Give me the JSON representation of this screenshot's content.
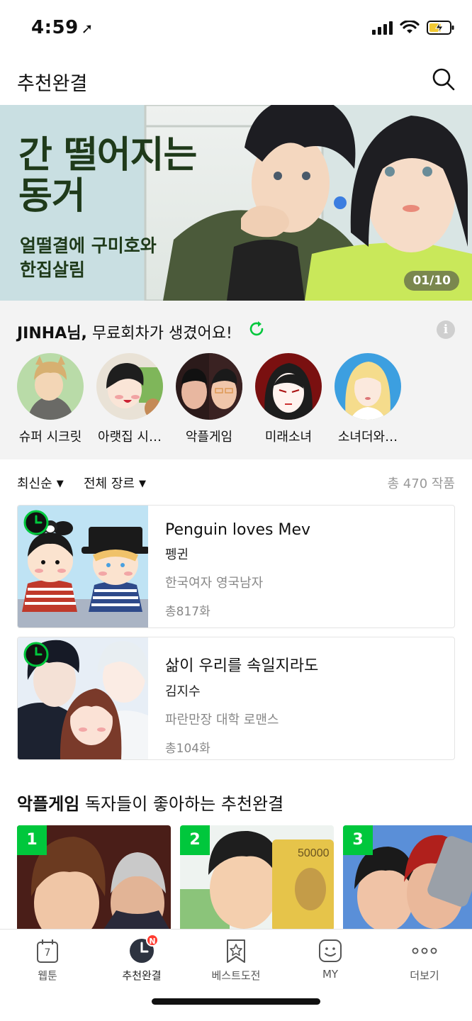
{
  "status_bar": {
    "time": "4:59"
  },
  "header": {
    "title": "추천완결"
  },
  "banner": {
    "title_line1": "간 떨어지는",
    "title_line2": "동거",
    "subtitle_line1": "얼떨결에 구미호와",
    "subtitle_line2": "한집살림",
    "counter": "01/10"
  },
  "free_episodes": {
    "user_name": "JINHA님,",
    "message": "무료회차가 생겼어요!",
    "items": [
      {
        "label": "슈퍼 시크릿"
      },
      {
        "label": "아랫집 시…"
      },
      {
        "label": "악플게임"
      },
      {
        "label": "미래소녀"
      },
      {
        "label": "소녀더와…"
      }
    ]
  },
  "filters": {
    "sort": "최신순",
    "genre": "전체 장르",
    "total": "총 470 작품"
  },
  "list": [
    {
      "title": "Penguin loves Mev",
      "author": "펭귄",
      "desc": "한국여자 영국남자",
      "count": "총817화"
    },
    {
      "title": "삶이 우리를 속일지라도",
      "author": "김지수",
      "desc": "파란만장 대학 로맨스",
      "count": "총104화"
    }
  ],
  "recommendation": {
    "highlight": "악플게임",
    "title_rest": "독자들이 좋아하는 추천완결",
    "items": [
      {
        "rank": "1"
      },
      {
        "rank": "2"
      },
      {
        "rank": "3"
      }
    ]
  },
  "bottom_nav": {
    "items": [
      {
        "label": "웹툰",
        "icon_text": "7"
      },
      {
        "label": "추천완결",
        "badge": "N"
      },
      {
        "label": "베스트도전"
      },
      {
        "label": "MY"
      },
      {
        "label": "더보기"
      }
    ]
  },
  "colors": {
    "accent_green": "#00c73c",
    "badge_red": "#ff3b30"
  }
}
